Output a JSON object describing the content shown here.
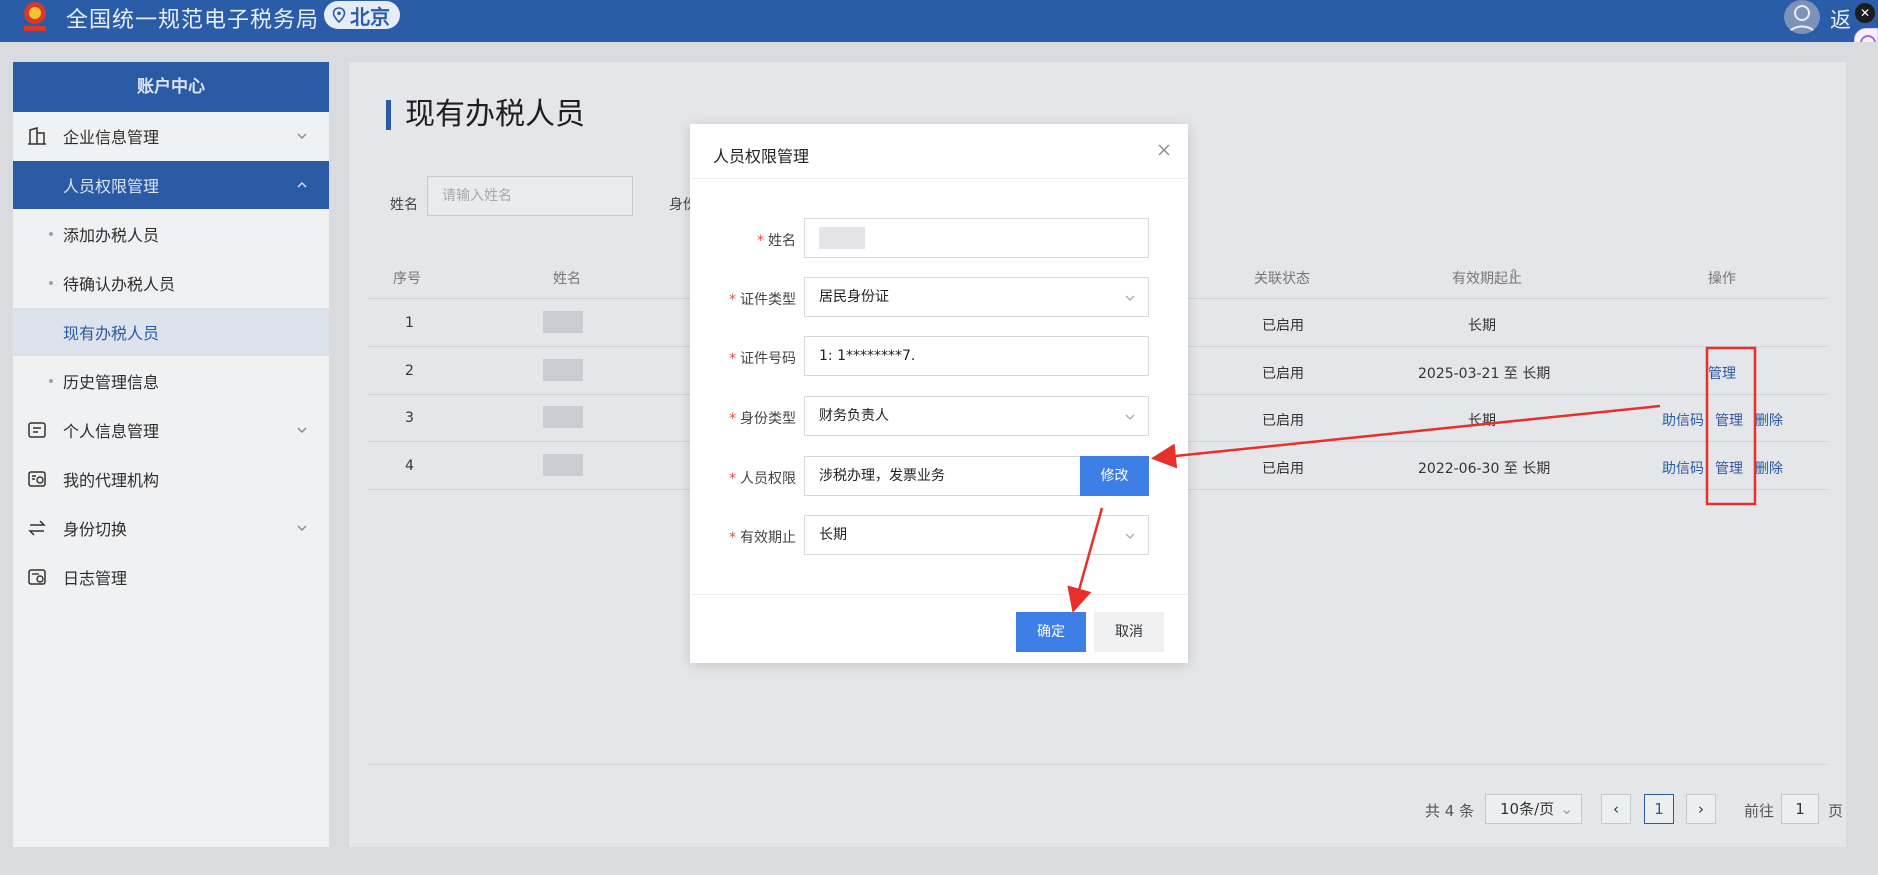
{
  "header": {
    "site_title": "全国统一规范电子税务局",
    "location": "北京",
    "back_label": "返"
  },
  "sidebar": {
    "title": "账户中心",
    "items": [
      {
        "label": "企业信息管理"
      },
      {
        "label": "人员权限管理"
      },
      {
        "label": "添加办税人员"
      },
      {
        "label": "待确认办税人员"
      },
      {
        "label": "现有办税人员"
      },
      {
        "label": "历史管理信息"
      },
      {
        "label": "个人信息管理"
      },
      {
        "label": "我的代理机构"
      },
      {
        "label": "身份切换"
      },
      {
        "label": "日志管理"
      }
    ]
  },
  "main": {
    "title": "现有办税人员",
    "filter": {
      "name_label": "姓名",
      "name_placeholder": "请输入姓名",
      "type_label": "身份"
    },
    "table": {
      "columns": [
        "序号",
        "姓名",
        "关联状态",
        "有效期起止",
        "操作"
      ],
      "rows": [
        {
          "index": "1",
          "status": "已启用",
          "validity": "长期",
          "ops": []
        },
        {
          "index": "2",
          "status": "已启用",
          "validity": "2025-03-21 至 长期",
          "ops": [
            "管理"
          ]
        },
        {
          "index": "3",
          "status": "已启用",
          "validity": "长期",
          "ops": [
            "助信码",
            "管理",
            "删除"
          ]
        },
        {
          "index": "4",
          "status": "已启用",
          "validity": "2022-06-30 至 长期",
          "ops": [
            "助信码",
            "管理",
            "删除"
          ]
        }
      ]
    },
    "pagination": {
      "total": "共 4 条",
      "page_size": "10条/页",
      "current_page": "1",
      "goto_label": "前往",
      "goto_value": "1",
      "page_unit": "页"
    }
  },
  "modal": {
    "title": "人员权限管理",
    "fields": [
      {
        "label": "姓名",
        "value": ""
      },
      {
        "label": "证件类型",
        "value": "居民身份证"
      },
      {
        "label": "证件号码",
        "value": "1:   1********7."
      },
      {
        "label": "身份类型",
        "value": "财务负责人"
      },
      {
        "label": "人员权限",
        "value": "涉税办理，发票业务"
      },
      {
        "label": "有效期止",
        "value": "长期"
      }
    ],
    "modify_label": "修改",
    "confirm_label": "确定",
    "cancel_label": "取消"
  },
  "colors": {
    "brand_blue": "#2a5ca8",
    "primary_button": "#3d7fe6",
    "annotation_red": "#e8302a"
  }
}
